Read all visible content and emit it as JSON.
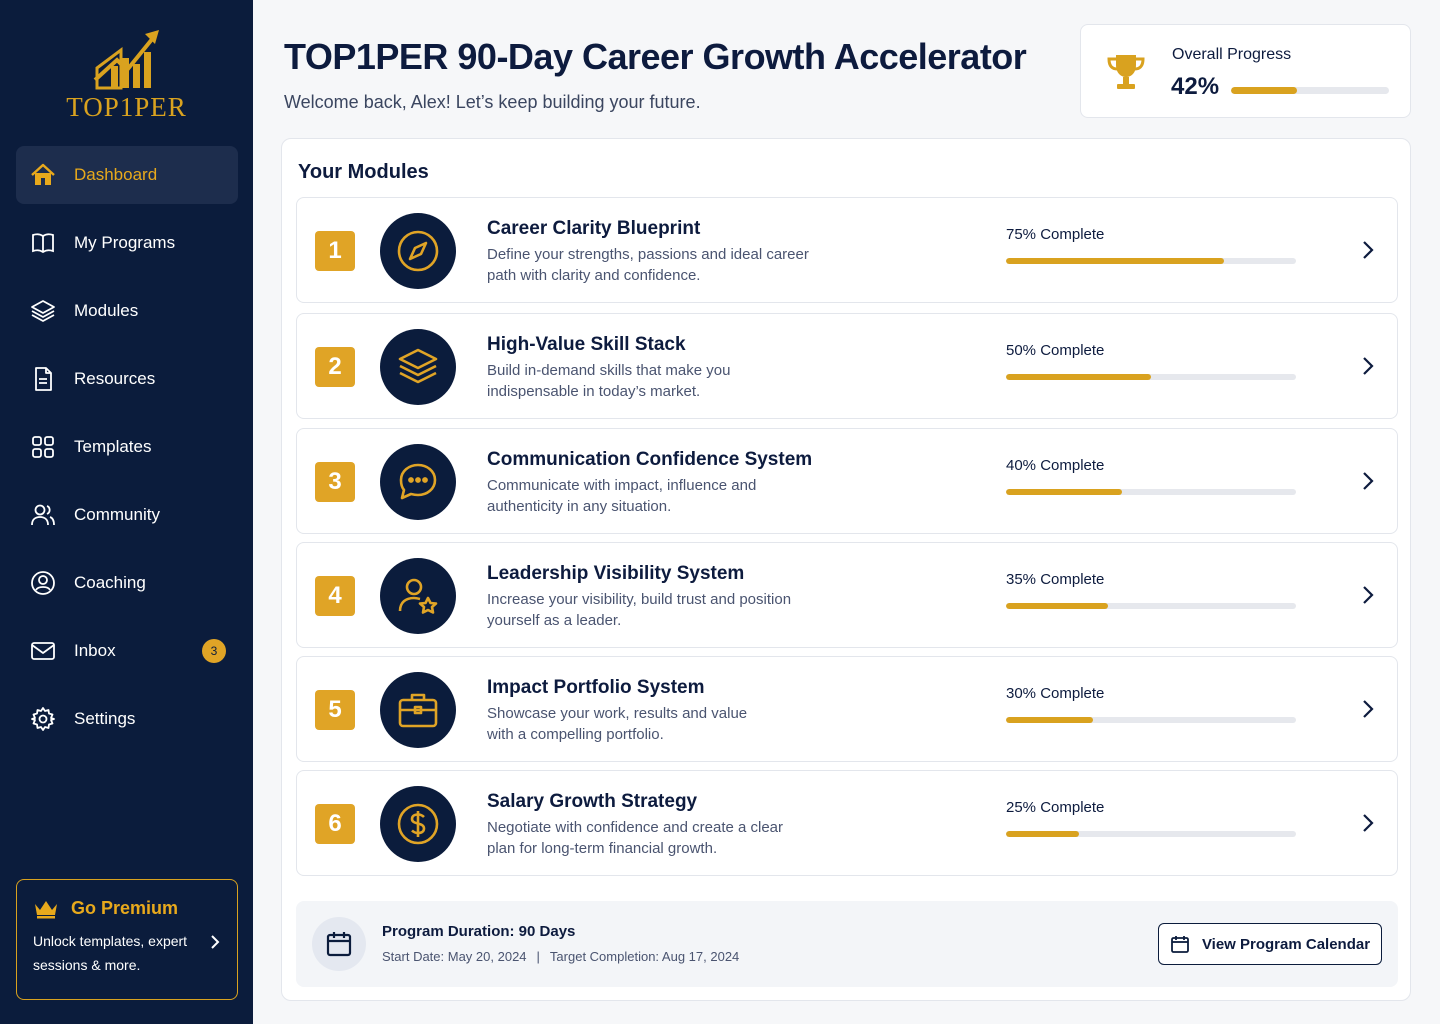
{
  "brand": {
    "name": "TOP1PER"
  },
  "sidebar": {
    "items": [
      {
        "label": "Dashboard",
        "icon": "home-icon",
        "active": true
      },
      {
        "label": "My Programs",
        "icon": "book-icon"
      },
      {
        "label": "Modules",
        "icon": "layers-icon"
      },
      {
        "label": "Resources",
        "icon": "document-icon"
      },
      {
        "label": "Templates",
        "icon": "grid-icon"
      },
      {
        "label": "Community",
        "icon": "users-icon"
      },
      {
        "label": "Coaching",
        "icon": "user-circle-icon"
      },
      {
        "label": "Inbox",
        "icon": "mail-icon",
        "badge": "3"
      },
      {
        "label": "Settings",
        "icon": "gear-icon"
      }
    ]
  },
  "premium": {
    "title": "Go Premium",
    "text": "Unlock templates, expert sessions & more."
  },
  "header": {
    "title": "TOP1PER 90-Day Career Growth Accelerator",
    "subtitle": "Welcome back, Alex! Let’s keep building your future."
  },
  "overall_progress": {
    "label": "Overall Progress",
    "value_text": "42%",
    "value": 0.42
  },
  "modules_section": {
    "title": "Your Modules",
    "modules": [
      {
        "number": "1",
        "title": "Career Clarity Blueprint",
        "desc_line1": "Define your strengths, passions and ideal career",
        "desc_line2": "path with clarity and confidence.",
        "progress_text": "75% Complete",
        "progress": 0.75,
        "icon": "compass-icon"
      },
      {
        "number": "2",
        "title": "High-Value Skill Stack",
        "desc_line1": "Build in-demand skills that make you",
        "desc_line2": "indispensable in today’s market.",
        "progress_text": "50% Complete",
        "progress": 0.5,
        "icon": "layers-icon"
      },
      {
        "number": "3",
        "title": "Communication Confidence System",
        "desc_line1": "Communicate with impact, influence and",
        "desc_line2": "authenticity in any situation.",
        "progress_text": "40% Complete",
        "progress": 0.4,
        "icon": "chat-icon"
      },
      {
        "number": "4",
        "title": "Leadership Visibility System",
        "desc_line1": "Increase your visibility, build trust and position",
        "desc_line2": "yourself as a leader.",
        "progress_text": "35% Complete",
        "progress": 0.35,
        "icon": "user-star-icon"
      },
      {
        "number": "5",
        "title": "Impact Portfolio System",
        "desc_line1": "Showcase your work, results and value",
        "desc_line2": "with a compelling portfolio.",
        "progress_text": "30% Complete",
        "progress": 0.3,
        "icon": "briefcase-icon"
      },
      {
        "number": "6",
        "title": "Salary Growth Strategy",
        "desc_line1": "Negotiate with confidence and create a clear",
        "desc_line2": "plan for long-term financial growth.",
        "progress_text": "25% Complete",
        "progress": 0.25,
        "icon": "dollar-icon"
      }
    ]
  },
  "program": {
    "duration_title": "Program Duration: 90 Days",
    "start": "Start Date: May 20, 2024",
    "separator": "|",
    "target": "Target Completion: Aug 17, 2024",
    "calendar_button": "View Program Calendar"
  },
  "colors": {
    "navy": "#0b1c3c",
    "gold": "#d9a21f",
    "accent": "#e0a426"
  }
}
